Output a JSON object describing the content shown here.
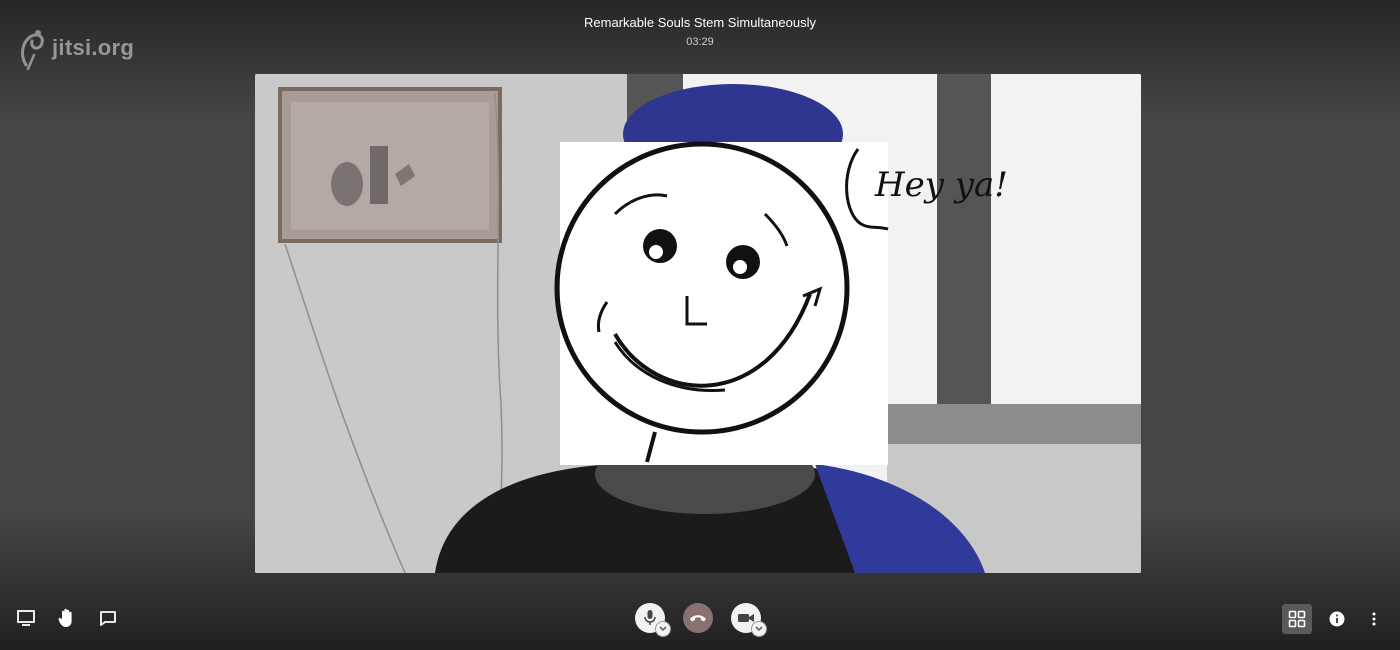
{
  "app": {
    "logo_text": "jitsi.org"
  },
  "meeting": {
    "title": "Remarkable Souls Stem Simultaneously",
    "timer": "03:29"
  },
  "video": {
    "overlay_drawing_text": "Hey ya!"
  },
  "toolbar": {
    "left": [
      {
        "name": "screen-share",
        "icon": "desktop-icon"
      },
      {
        "name": "raise-hand",
        "icon": "hand-icon"
      },
      {
        "name": "chat",
        "icon": "chat-bubble-icon"
      }
    ],
    "center": [
      {
        "name": "microphone",
        "icon": "microphone-icon",
        "has_options": true
      },
      {
        "name": "hangup",
        "icon": "phone-hangup-icon",
        "has_options": false
      },
      {
        "name": "camera",
        "icon": "video-camera-icon",
        "has_options": true
      }
    ],
    "right": [
      {
        "name": "tile-view",
        "icon": "grid-icon",
        "active": true
      },
      {
        "name": "info",
        "icon": "info-icon",
        "active": false
      },
      {
        "name": "more",
        "icon": "more-vertical-icon",
        "active": false
      }
    ]
  },
  "colors": {
    "background": "#464646",
    "hangup": "#8a7070",
    "button_light": "#f2f2f2"
  }
}
